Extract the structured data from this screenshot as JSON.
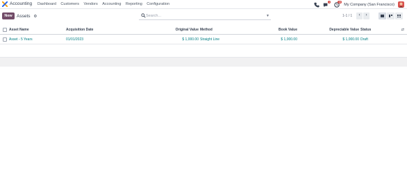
{
  "navbar": {
    "app_name": "Accounting",
    "menu": [
      "Dashboard",
      "Customers",
      "Vendors",
      "Accounting",
      "Reporting",
      "Configuration"
    ],
    "chat_badge": "1",
    "activity_badge": "15",
    "company": "My Company (San Francisco)"
  },
  "control": {
    "new_label": "New",
    "breadcrumb": "Assets",
    "search_placeholder": "Search...",
    "pager": "1-1 / 1"
  },
  "table": {
    "columns": [
      "Asset Name",
      "Acquisition Date",
      "Original Value",
      "Method",
      "Book Value",
      "Depreciable Value",
      "Status"
    ],
    "rows": [
      {
        "name": "Asset - 5 Years",
        "date": "01/01/2023",
        "original_value": "$ 1,000.00",
        "method": "Straight Line",
        "book_value": "$ 1,000.00",
        "depreciable_value": "$ 1,000.00",
        "status": "Draft"
      }
    ]
  },
  "colors": {
    "brand": "#714b67",
    "link": "#017e84",
    "badge": "#d0443e"
  }
}
